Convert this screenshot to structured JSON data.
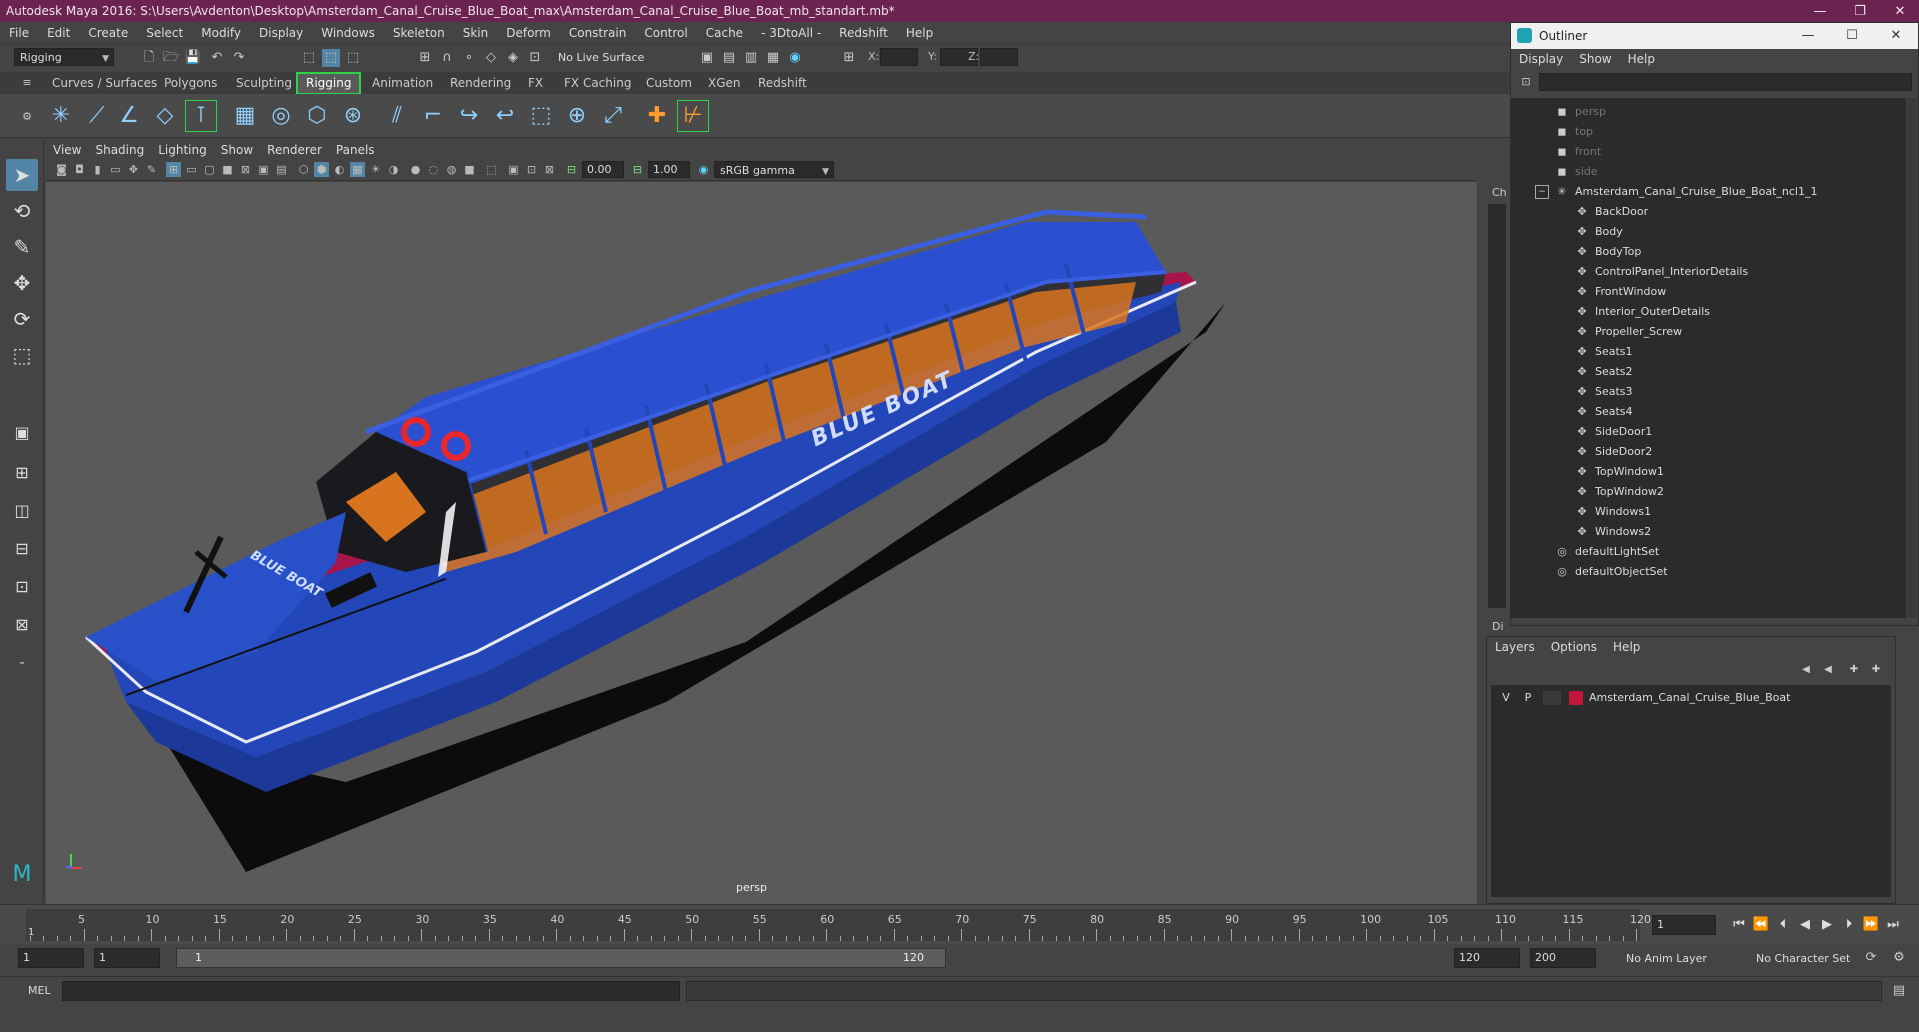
{
  "window": {
    "title": "Autodesk Maya 2016: S:\\Users\\Avdenton\\Desktop\\Amsterdam_Canal_Cruise_Blue_Boat_max\\Amsterdam_Canal_Cruise_Blue_Boat_mb_standart.mb*",
    "minimize": "—",
    "maximize": "❐",
    "close": "✕"
  },
  "menubar": [
    "File",
    "Edit",
    "Create",
    "Select",
    "Modify",
    "Display",
    "Windows",
    "Skeleton",
    "Skin",
    "Deform",
    "Constrain",
    "Control",
    "Cache",
    "- 3DtoAll -",
    "Redshift",
    "Help"
  ],
  "statusline": {
    "mode": "Rigging",
    "live_surface": "No Live Surface",
    "x_label": "X:",
    "y_label": "Y:",
    "z_label": "Z:"
  },
  "shelf_tabs": [
    "Curves / Surfaces",
    "Polygons",
    "Sculpting",
    "Rigging",
    "Animation",
    "Rendering",
    "FX",
    "FX Caching",
    "Custom",
    "XGen",
    "Redshift"
  ],
  "shelf_active": "Rigging",
  "viewport": {
    "menu": [
      "View",
      "Shading",
      "Lighting",
      "Show",
      "Renderer",
      "Panels"
    ],
    "exposure": "0.00",
    "gamma": "1.00",
    "colorspace": "sRGB gamma",
    "camera_label": "persp",
    "boat_text": "BLUE BOAT",
    "colors": {
      "background": "#5a5a5a",
      "hull_blue": "#2346b8",
      "hull_red": "#a8154a",
      "seat_orange": "#d9741e"
    }
  },
  "outliner": {
    "title": "Outliner",
    "menu": [
      "Display",
      "Show",
      "Help"
    ],
    "cameras": [
      "persp",
      "top",
      "front",
      "side"
    ],
    "group": "Amsterdam_Canal_Cruise_Blue_Boat_ncl1_1",
    "children": [
      "BackDoor",
      "Body",
      "BodyTop",
      "ControlPanel_InteriorDetails",
      "FrontWindow",
      "Interior_OuterDetails",
      "Propeller_Screw",
      "Seats1",
      "Seats2",
      "Seats3",
      "Seats4",
      "SideDoor1",
      "SideDoor2",
      "TopWindow1",
      "TopWindow2",
      "Windows1",
      "Windows2"
    ],
    "sets": [
      "defaultLightSet",
      "defaultObjectSet"
    ]
  },
  "sidepanel": {
    "channel_tab": "Ch",
    "display_tab": "Di"
  },
  "layers": {
    "menu": [
      "Layers",
      "Options",
      "Help"
    ],
    "row": {
      "v": "V",
      "p": "P",
      "name": "Amsterdam_Canal_Cruise_Blue_Boat",
      "color": "#c0183a"
    }
  },
  "timeline": {
    "ticks": [
      "5",
      "10",
      "15",
      "20",
      "25",
      "30",
      "35",
      "40",
      "45",
      "50",
      "55",
      "60",
      "65",
      "70",
      "75",
      "80",
      "85",
      "90",
      "95",
      "100",
      "105",
      "110",
      "115",
      "120"
    ],
    "current_marker": "1",
    "current_frame": "1"
  },
  "range": {
    "start": "1",
    "playback_start": "1",
    "slider_start": "1",
    "slider_end": "120",
    "playback_end": "120",
    "end": "200",
    "anim_layer": "No Anim Layer",
    "character_set": "No Character Set"
  },
  "cmdline": {
    "label": "MEL"
  }
}
